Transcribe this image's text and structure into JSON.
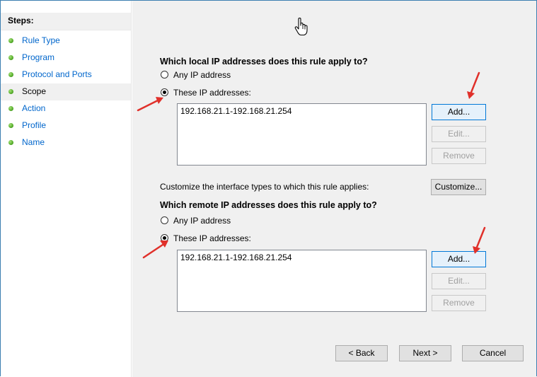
{
  "sidebar": {
    "header": "Steps:",
    "items": [
      {
        "label": "Rule Type"
      },
      {
        "label": "Program"
      },
      {
        "label": "Protocol and Ports"
      },
      {
        "label": "Scope"
      },
      {
        "label": "Action"
      },
      {
        "label": "Profile"
      },
      {
        "label": "Name"
      }
    ],
    "active_item": "Scope"
  },
  "local": {
    "heading": "Which local IP addresses does this rule apply to?",
    "any_label": "Any IP address",
    "these_label": "These IP addresses:",
    "selected": "these",
    "addresses": [
      "192.168.21.1-192.168.21.254"
    ],
    "add_label": "Add...",
    "edit_label": "Edit...",
    "remove_label": "Remove"
  },
  "interface": {
    "text": "Customize the interface types to which this rule applies:",
    "button_label": "Customize..."
  },
  "remote": {
    "heading": "Which remote IP addresses does this rule apply to?",
    "any_label": "Any IP address",
    "these_label": "These IP addresses:",
    "selected": "these",
    "addresses": [
      "192.168.21.1-192.168.21.254"
    ],
    "add_label": "Add...",
    "edit_label": "Edit...",
    "remove_label": "Remove"
  },
  "footer": {
    "back_label": "< Back",
    "next_label": "Next >",
    "cancel_label": "Cancel"
  },
  "colors": {
    "frame": "#3c7fb1",
    "link": "#0066cc",
    "step_dot": "#5bb12f",
    "annotation_arrow": "#e0302a",
    "panel_bg": "#f0f0f0"
  },
  "icons": {
    "cursor": "hand-pointer-icon",
    "step_marker": "green-dot-icon",
    "annotation": "red-arrow-icon"
  }
}
